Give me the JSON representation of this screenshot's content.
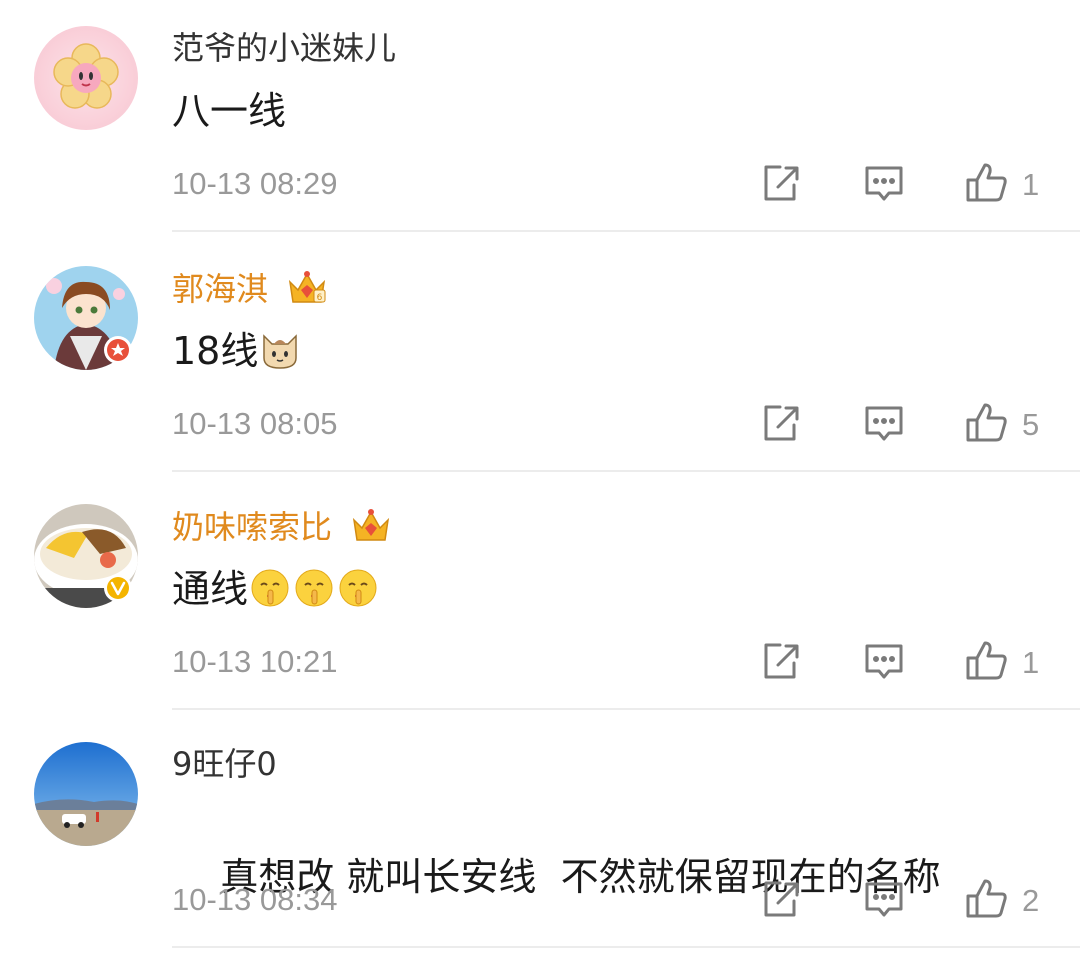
{
  "comments": [
    {
      "username": "范爷的小迷妹儿",
      "content": "八一线",
      "time": "10-13 08:29",
      "likes": "1",
      "name_color": "#333333",
      "avatar_icon": "pink-flower-kirby-avatar"
    },
    {
      "username": "郭海淇",
      "content": "18线",
      "time": "10-13 08:05",
      "likes": "5",
      "name_color": "#e08a1e",
      "badge_icon": "vip-crown-icon",
      "avatar_icon": "anime-girl-avatar",
      "emoji": "cat-face-emoji"
    },
    {
      "username": "奶味嗦索比",
      "content": "通线",
      "time": "10-13 10:21",
      "likes": "1",
      "name_color": "#e08a1e",
      "badge_icon": "vip-crown-icon",
      "avatar_icon": "food-bowl-avatar",
      "emoji": "shushing-face-emoji"
    },
    {
      "username": "9旺仔0",
      "content": "真想改 就叫长安线  不然就保留现在的名称",
      "time": "10-13 08:34",
      "likes": "2",
      "name_color": "#333333",
      "avatar_icon": "landscape-car-avatar"
    }
  ],
  "icons": {
    "share": "share-icon",
    "reply": "comment-icon",
    "like": "thumbs-up-icon"
  },
  "colors": {
    "text_secondary": "#999999",
    "vip_name": "#e08a1e",
    "divider": "#ececec"
  }
}
